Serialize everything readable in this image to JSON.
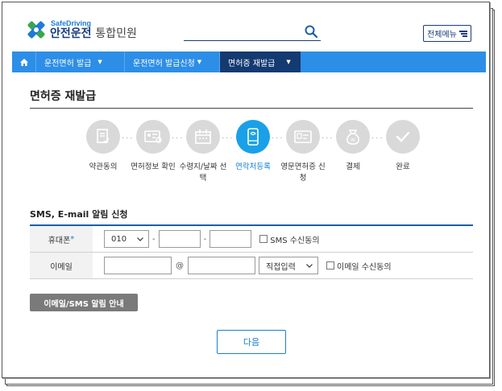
{
  "header": {
    "logo_sub": "SafeDriving",
    "logo_main": "안전운전",
    "logo_main_thin": "통합민원",
    "all_menu_label": "전체메뉴"
  },
  "nav": {
    "items": [
      {
        "label": "운전면허 발급"
      },
      {
        "label": "운전면허 발급신청"
      },
      {
        "label": "면허증 재발급"
      }
    ]
  },
  "page": {
    "title": "면허증 재발급"
  },
  "steps": [
    {
      "label": "약관동의"
    },
    {
      "label": "면허정보 확인"
    },
    {
      "label": "수령지/날짜 선택"
    },
    {
      "label": "연락처등록"
    },
    {
      "label": "영문면허증 신청"
    },
    {
      "label": "결제"
    },
    {
      "label": "완료"
    }
  ],
  "active_step": 3,
  "sms": {
    "section_title": "SMS, E-mail 알림 신청",
    "phone_label": "휴대폰",
    "required_mark": "*",
    "phone_prefix": "010",
    "phone_sep": "-",
    "sms_consent": "SMS 수신동의",
    "email_label": "이메일",
    "email_at": "@",
    "email_domain_select": "직접입력",
    "email_consent": "이메일 수신동의"
  },
  "buttons": {
    "guide": "이메일/SMS 알림 안내",
    "next": "다음"
  },
  "colors": {
    "nav_bg": "#2d8ee8",
    "nav_active": "#143a72",
    "step_active": "#1aa0e8",
    "step_inactive": "#d9d9d9",
    "link_blue": "#1a80d0"
  }
}
